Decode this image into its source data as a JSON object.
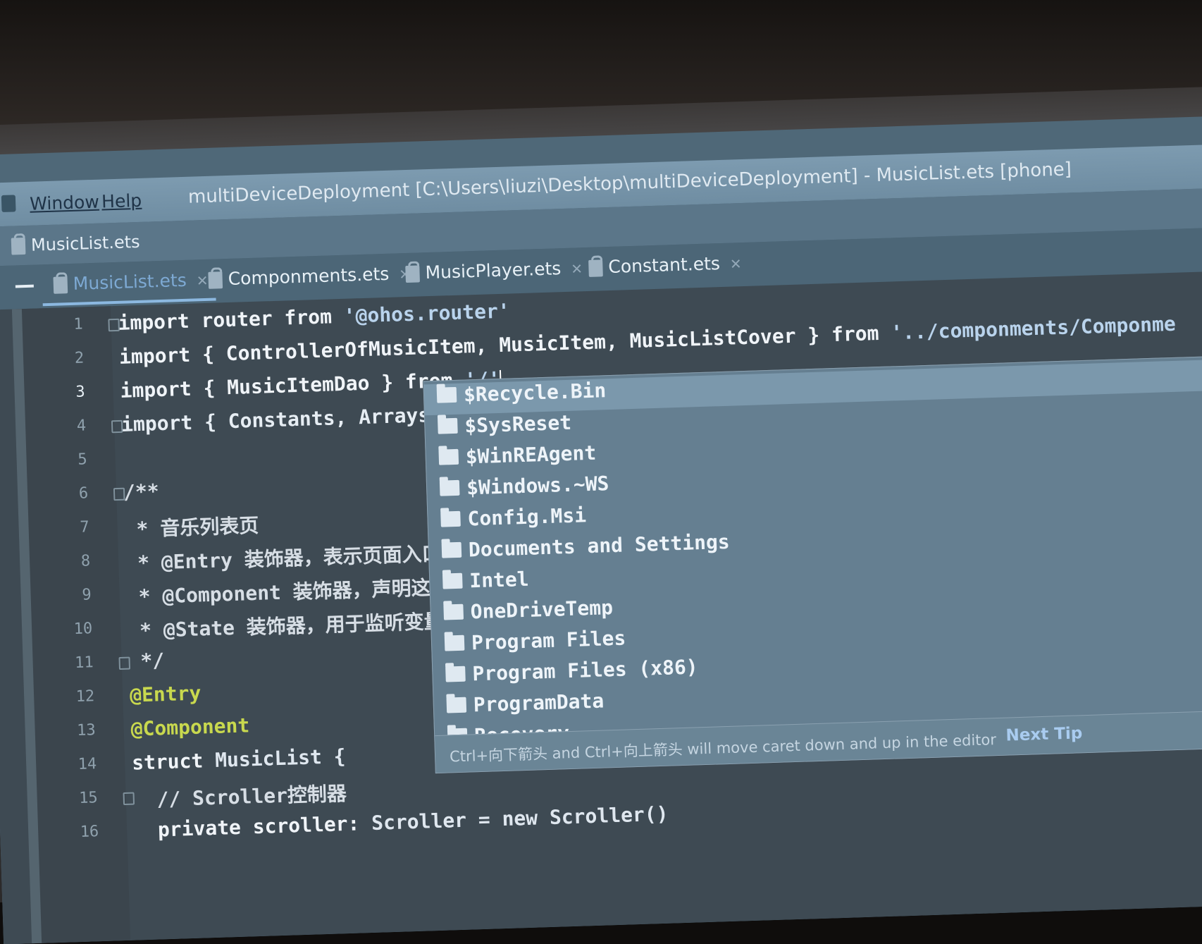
{
  "menu": {
    "window": "Window",
    "help": "Help"
  },
  "window_title": "multiDeviceDeployment [C:\\Users\\liuzi\\Desktop\\multiDeviceDeployment] - MusicList.ets [phone]",
  "breadcrumb": "MusicList.ets",
  "tabs": [
    {
      "label": "MusicList.ets",
      "active": true
    },
    {
      "label": "Componments.ets",
      "active": false
    },
    {
      "label": "MusicPlayer.ets",
      "active": false
    },
    {
      "label": "Constant.ets",
      "active": false
    }
  ],
  "line_numbers": [
    "1",
    "2",
    "3",
    "4",
    "5",
    "6",
    "7",
    "8",
    "9",
    "10",
    "11",
    "12",
    "13",
    "14",
    "15",
    "16"
  ],
  "code": {
    "l1a": "import router from ",
    "l1b": "'@ohos.router'",
    "l2a": "import { ControllerOfMusicItem, MusicItem, MusicListCover } from ",
    "l2b": "'../componments/Componme",
    "l3a": "import { MusicItemDao } from ",
    "l3b": "'/'",
    "l4": "import { Constants, Arrays,",
    "l6": "/**",
    "l7": " * 音乐列表页",
    "l8": " * @Entry 装饰器，表示页面入口",
    "l9": " * @Component 装饰器，声明这是",
    "l10": " * @State 装饰器，用于监听变量",
    "l11": " */",
    "l12": "@Entry",
    "l13": "@Component",
    "l14a": "struct ",
    "l14b": "MusicList {",
    "l15": "  // Scroller控制器",
    "l16a": "  private scroller: ",
    "l16b": "Scroller = new Scroller()"
  },
  "autocomplete": {
    "items": [
      "$Recycle.Bin",
      "$SysReset",
      "$WinREAgent",
      "$Windows.~WS",
      "Config.Msi",
      "Documents and Settings",
      "Intel",
      "OneDriveTemp",
      "Program Files",
      "Program Files (x86)",
      "ProgramData",
      "Recovery"
    ],
    "hint": "Ctrl+向下箭头 and Ctrl+向上箭头 will move caret down and up in the editor",
    "next_tip": "Next Tip"
  }
}
